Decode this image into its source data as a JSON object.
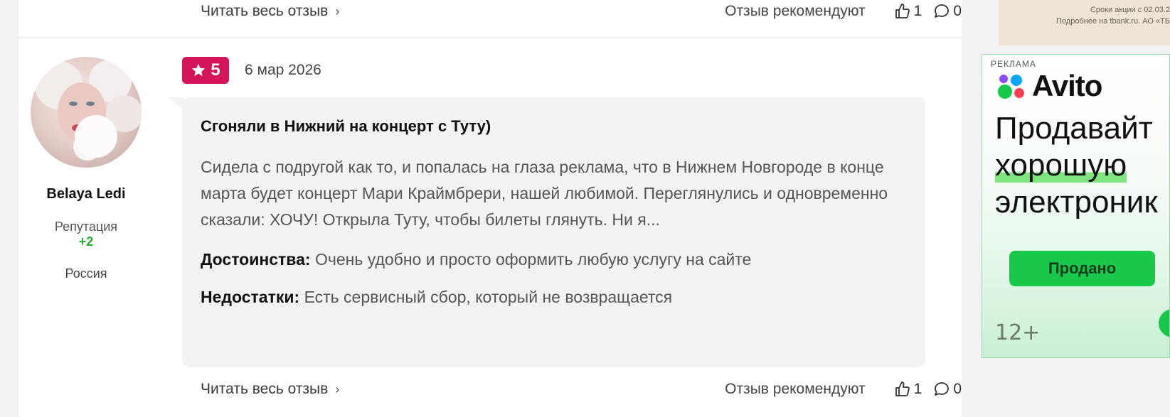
{
  "top_footer": {
    "read_full": "Читать весь отзыв",
    "recommend_label": "Отзыв рекомендуют",
    "likes": "1",
    "comments": "0"
  },
  "review": {
    "user": {
      "name": "Belaya Ledi",
      "reputation_label": "Репутация",
      "reputation_value": "+2",
      "country": "Россия"
    },
    "rating": "5",
    "date": "6 мар 2026",
    "title": "Сгоняли в Нижний на концерт с Туту)",
    "text": "Сидела с подругой как то, и попалась на глаза реклама, что в Нижнем Новгороде в конце марта будет концерт Мари Краймбрери, нашей любимой. Переглянулись и одновременно сказали: ХОЧУ! Открыла Туту, чтобы билеты глянуть. Ни я...",
    "pros_label": "Достоинства:",
    "pros_text": "Очень удобно и просто оформить любую услугу на сайте",
    "cons_label": "Недостатки:",
    "cons_text": "Есть сервисный сбор, который не возвращается",
    "footer": {
      "read_full": "Читать весь отзыв",
      "recommend_label": "Отзыв рекомендуют",
      "likes": "1",
      "comments": "0"
    }
  },
  "ads": {
    "top_banner": {
      "line1": "Сроки акции с 02.03.2",
      "line2": "Подробнее на tbank.ru. АО «ТБ"
    },
    "avito": {
      "label": "РЕКЛАМА",
      "brand": "Avito",
      "headline_line1": "Продавайт",
      "headline_line2": "хорошую",
      "headline_line3": "электроник",
      "button": "Продано",
      "age": "12+"
    }
  },
  "colors": {
    "rating_badge": "#d4145a",
    "reputation": "#1fae2a",
    "avito_button": "#19c84b"
  }
}
